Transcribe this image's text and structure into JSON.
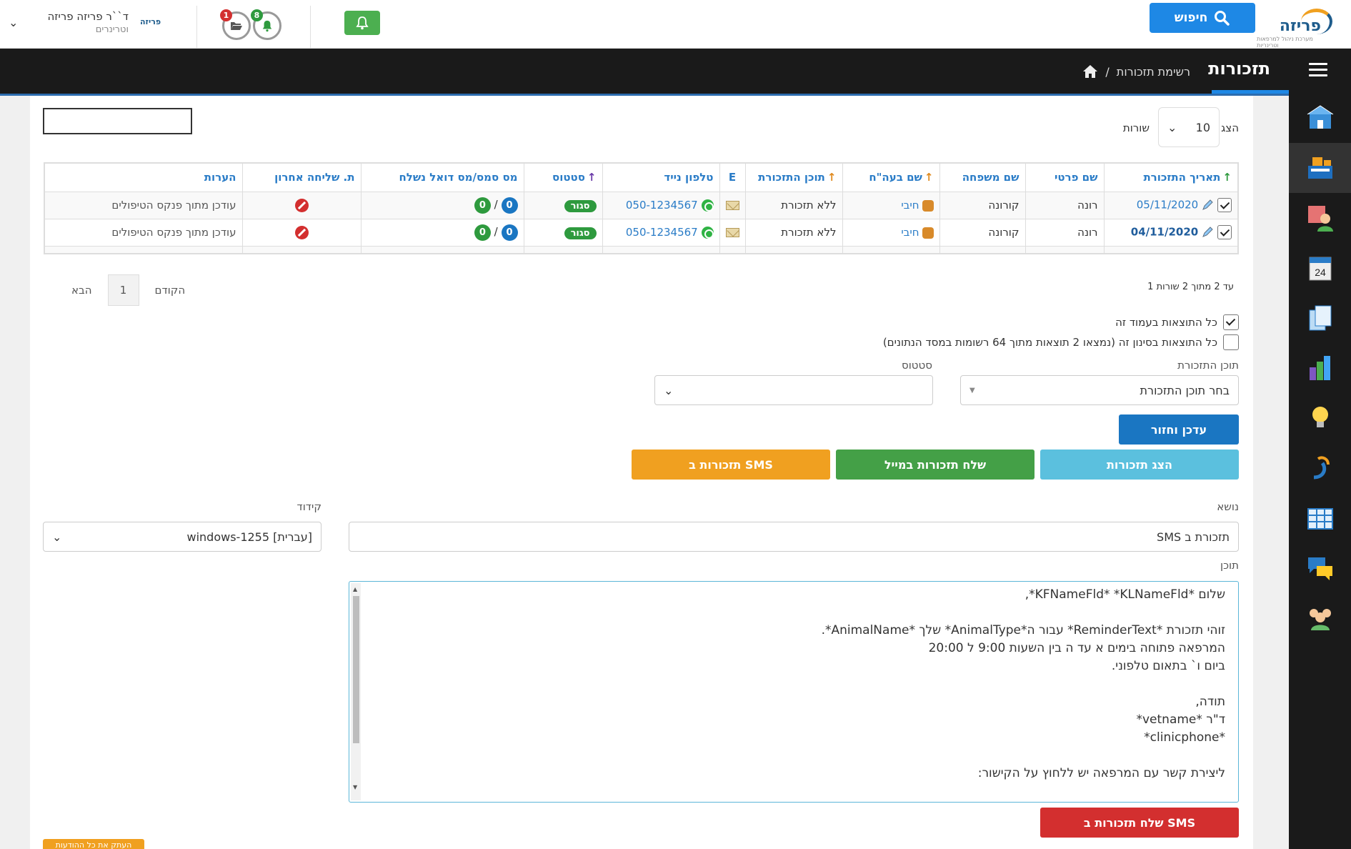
{
  "topbar": {
    "logo_text": "פריזה",
    "logo_sub": "מערכת ניהול למרפאות וטרינריות",
    "search_label": "חיפוש",
    "notif_count": "8",
    "docs_count": "1",
    "user_name": "ד``ר פריזה פריזה",
    "user_role": "וטרינרים",
    "small_logo": "פריזה"
  },
  "header": {
    "title": "תזכורות",
    "breadcrumb": "רשימת תזכורות",
    "breadcrumb_sep": "/"
  },
  "list_controls": {
    "show_label": "הצג",
    "rows_value": "10",
    "rows_label": "שורות"
  },
  "table": {
    "columns": [
      "תאריך התזכורת",
      "שם פרטי",
      "שם משפחה",
      "שם בעה\"ח",
      "תוכן התזכורת",
      "E",
      "טלפון נייד",
      "סטטוס",
      "מס סמס/מס דואל נשלח",
      "ת. שליחה אחרון",
      "הערות"
    ],
    "rows": [
      {
        "date": "05/11/2020",
        "first": "רונה",
        "last": "קורונה",
        "pet": "חיבי",
        "content": "ללא תזכורת",
        "phone": "050-1234567",
        "status": "סגור",
        "sms": "0",
        "mail": "0",
        "slash": "/",
        "notes": "עודכן מתוך פנקס הטיפולים"
      },
      {
        "date": "04/11/2020",
        "first": "רונה",
        "last": "קורונה",
        "pet": "חיבי",
        "content": "ללא תזכורת",
        "phone": "050-1234567",
        "status": "סגור",
        "sms": "0",
        "mail": "0",
        "slash": "/",
        "notes": "עודכן מתוך פנקס הטיפולים"
      }
    ]
  },
  "pager": {
    "info": "1 עד 2 מתוך 2 שורות",
    "prev": "הקודם",
    "page": "1",
    "next": "הבא"
  },
  "selection": {
    "all_page": "כל התוצאות בעמוד זה",
    "all_filter": "כל התוצאות בסינון זה (נמצאו 2 תוצאות מתוך 64 רשומות במסד הנתונים)"
  },
  "filters": {
    "content_label": "תוכן התזכורת",
    "content_value": "בחר תוכן התזכורת",
    "status_label": "סטטוס",
    "status_value": ""
  },
  "buttons": {
    "update_return": "עדכן וחזור",
    "show_reminders": "הצג תזכורות",
    "send_mail": "שלח תזכורות במייל",
    "sms_reminders": "תזכורות ב SMS",
    "send_sms": "שלח תזכורות ב SMS",
    "copy_all": "העתק את כל ההודעות"
  },
  "message": {
    "subject_label": "נושא",
    "subject_value": "תזכורת ב SMS",
    "encoding_label": "קידוד",
    "encoding_value": "windows-1255 [עברית]",
    "content_label": "תוכן",
    "content_lines": [
      "שלום *KFNameFld* *KLNameFld*,",
      "",
      "זוהי תזכורת *ReminderText* עבור ה*AnimalType* שלך *AnimalName*.",
      "המרפאה פתוחה בימים א עד ה בין השעות 9:00 ל 20:00",
      "ביום ו` בתאום טלפוני.",
      "",
      "תודה,",
      "ד\"ר *vetname*",
      "*clinicphone*",
      "",
      "ליצירת קשר עם המרפאה יש ללחוץ על הקישור:"
    ]
  },
  "colors": {
    "primary": "#1e88e5",
    "info": "#5bc0de",
    "success": "#44a047",
    "warning": "#f0a020",
    "danger": "#d32f2f",
    "dark": "#1a1a1a"
  }
}
